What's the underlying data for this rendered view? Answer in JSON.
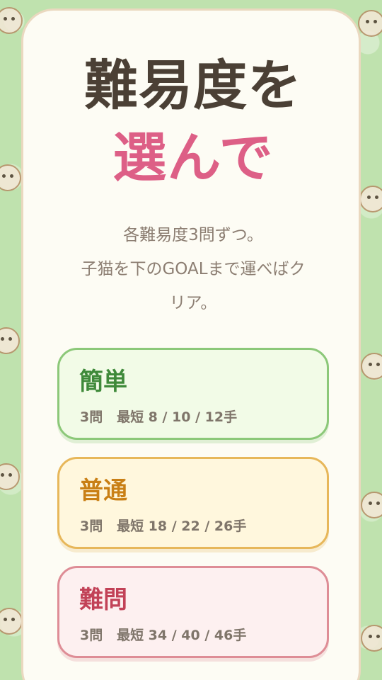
{
  "title": {
    "line1": "難易度を",
    "line2": "選んで"
  },
  "description": {
    "line1": "各難易度3問ずつ。",
    "line2": "子猫を下のGOALまで運べばク",
    "line3": "リア。"
  },
  "difficulties": [
    {
      "name": "簡単",
      "info": "3問   最短 8 / 10 / 12手",
      "color": "#8cc879"
    },
    {
      "name": "普通",
      "info": "3問   最短 18 / 22 / 26手",
      "color": "#e7b75a"
    },
    {
      "name": "難問",
      "info": "3問   最短 34 / 40 / 46手",
      "color": "#de8d96"
    }
  ],
  "colors": {
    "background": "#bfe2ae",
    "card": "#fdfcf4",
    "title_dark": "#4b4035",
    "title_accent": "#dd5f86"
  },
  "icons": {
    "background": "dog-and-cat-pattern"
  }
}
